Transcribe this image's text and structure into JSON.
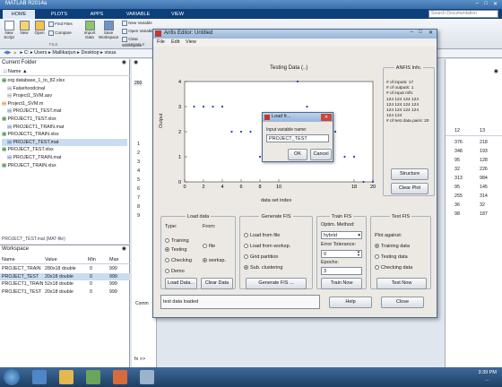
{
  "window": {
    "title": "MATLAB R2014a"
  },
  "ribbon": {
    "tabs": [
      "HOME",
      "PLOTS",
      "APPS",
      "VARIABLE",
      "VIEW"
    ],
    "buttons": [
      "New Script",
      "New",
      "Open",
      "Find Files",
      "Compare",
      "Import Data",
      "Save Workspace",
      "New Variable",
      "Open Variable",
      "Clear Workspace"
    ],
    "section_label": "FILE",
    "variable_label": "VARIABLE",
    "search_placeholder": "Search Documentation"
  },
  "address": {
    "segments": [
      "C:",
      "Users",
      "Mallikarjun",
      "Desktop",
      "visua"
    ]
  },
  "current_folder": {
    "title": "Current Folder",
    "column": "Name",
    "files": [
      "org database_1_to_82.xlsx",
      "Falsehoodcinal",
      "Project1_SVM.asv",
      "Project1_SVM.m",
      "PROJECT1_TEST.mat",
      "PROJECT1_TEST.xlsx",
      "PROJECT1_TRAIN.mat",
      "PROJECT1_TRAIN.xlsx",
      "PROJECT_TEST.mat",
      "PROJECT_TEST.xlsx",
      "PROJECT_TRAIN.mat",
      "PROJECT_TRAIN.xlsx"
    ],
    "status": "PROJECT_TEST.mat (MAT-file)"
  },
  "workspace": {
    "title": "Workspace",
    "columns": [
      "Name",
      "Value",
      "Min",
      "Max"
    ],
    "rows": [
      [
        "PROJECT_TRAIN",
        "280x18 double",
        "0",
        "999"
      ],
      [
        "PROJECT_TEST",
        "20x18 double",
        "0",
        "999"
      ],
      [
        "PROJECT1_TRAIN",
        "52x18 double",
        "0",
        "999"
      ],
      [
        "PROJECT1_TEST",
        "20x18 double",
        "0",
        "999"
      ]
    ]
  },
  "editor": {
    "tab_label": "260",
    "rows": [
      "1",
      "2",
      "3",
      "4",
      "5",
      "6",
      "7",
      "8",
      "9"
    ],
    "cmd_label": "Comm",
    "fx": "fx >>"
  },
  "right_grid": {
    "headers": [
      "12",
      "13"
    ],
    "rows": [
      [
        "376",
        "218"
      ],
      [
        "348",
        "193"
      ],
      [
        "95",
        "128"
      ],
      [
        "32",
        "226"
      ],
      [
        "313",
        "984"
      ],
      [
        "95",
        "145"
      ],
      [
        "255",
        "314"
      ],
      [
        "36",
        "32"
      ],
      [
        "98",
        "187"
      ]
    ]
  },
  "anfis": {
    "title": "Anfis Editor: Untitled",
    "menu": [
      "File",
      "Edit",
      "View"
    ],
    "plot": {
      "title": "Testing Data (..)",
      "ylabel": "Output",
      "xlabel": "data set index",
      "xticks": [
        "0",
        "2",
        "4",
        "6",
        "8",
        "10",
        "18",
        "20"
      ],
      "yticks": [
        "0",
        "1",
        "2",
        "3",
        "4"
      ]
    },
    "info": {
      "title": "ANFIS Info.",
      "lines": [
        "# of inputs: 17",
        "# of outputs: 1",
        "# of input mfs:",
        "124 124 124 124",
        "124 124 124 124",
        "124 124 124 124",
        "124 124",
        "# of test data pairs: 20"
      ]
    },
    "structure_btn": "Structure",
    "clear_plot_btn": "Clear Plot",
    "load_data": {
      "title": "Load data",
      "type_label": "Type:",
      "from_label": "From:",
      "type_options": [
        "Training",
        "Testing",
        "Checking",
        "Demo"
      ],
      "from_options": [
        "file",
        "worksp."
      ],
      "load_btn": "Load Data...",
      "clear_btn": "Clear Data"
    },
    "generate_fis": {
      "title": "Generate FIS",
      "options": [
        "Load from file",
        "Load from worksp.",
        "Grid partition",
        "Sub. clustering"
      ],
      "btn": "Generate FIS ..."
    },
    "train_fis": {
      "title": "Train FIS",
      "optim_label": "Optim. Method:",
      "method": "hybrid",
      "error_label": "Error Tolerance:",
      "error_value": "0",
      "epochs_label": "Epochs:",
      "epochs_value": "3",
      "btn": "Train Now"
    },
    "test_fis": {
      "title": "Test FIS",
      "plot_label": "Plot against:",
      "options": [
        "Training data",
        "Testing data",
        "Checking data"
      ],
      "btn": "Test Now"
    },
    "status": "test data loaded",
    "help_btn": "Help",
    "close_btn": "Close"
  },
  "dialog": {
    "title": "Load fr...",
    "prompt": "Input variable name:",
    "value": "PROJECT_TEST",
    "ok": "OK",
    "cancel": "Cancel"
  },
  "taskbar": {
    "time": "3:39 PM",
    "date": "..."
  },
  "chart_data": {
    "type": "scatter",
    "title": "Testing Data (..)",
    "xlabel": "data set index",
    "ylabel": "Output",
    "xlim": [
      0,
      20
    ],
    "ylim": [
      0,
      4
    ],
    "series": [
      {
        "x": [
          1,
          2,
          3,
          4,
          5,
          6,
          7,
          8,
          9,
          10,
          11,
          12,
          13,
          14,
          15,
          16,
          17,
          18,
          19,
          20
        ],
        "y": [
          3,
          3,
          3,
          3,
          2,
          2,
          2,
          1,
          1,
          1,
          1,
          4,
          3,
          2,
          2,
          2,
          1,
          1,
          0,
          0
        ]
      }
    ]
  }
}
